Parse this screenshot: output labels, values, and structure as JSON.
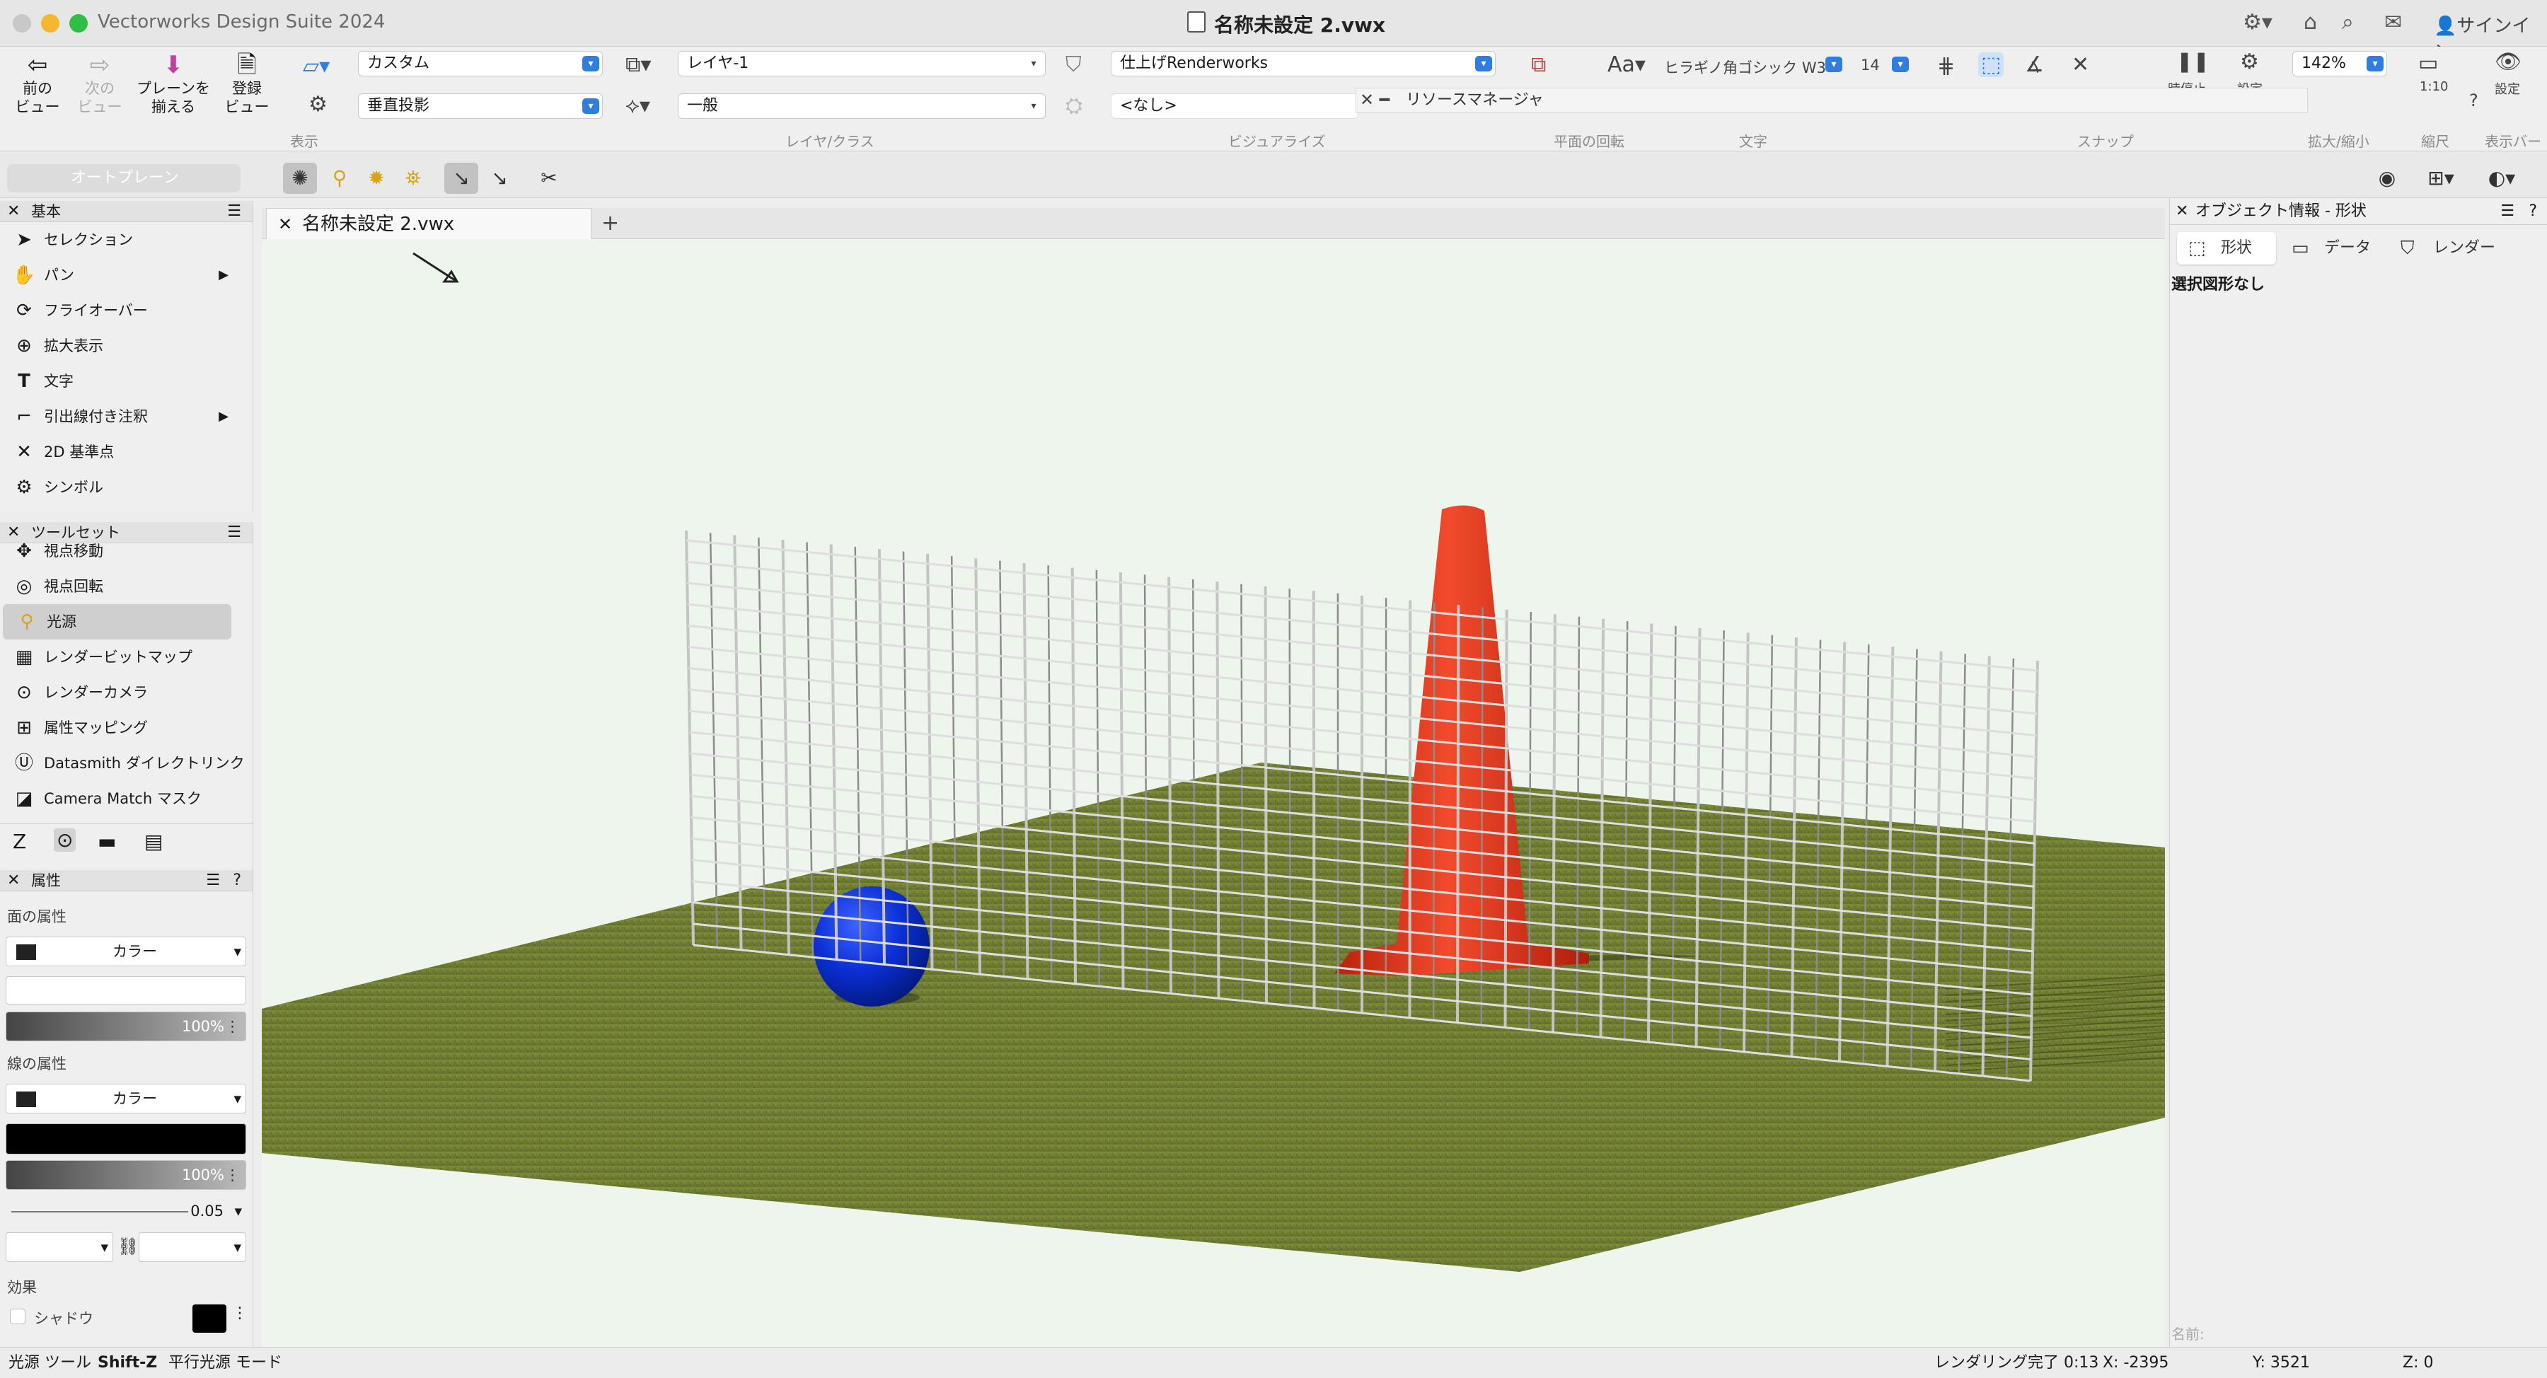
{
  "window": {
    "app_title": "Vectorworks Design Suite 2024",
    "doc_title": "名称未設定 2.vwx",
    "signin": "サインイン"
  },
  "nav": {
    "prev_view": "前の\nビュー",
    "next_view": "次の\nビュー",
    "align_plane": "プレーンを\n揃える",
    "saved_view": "登録\nビュー"
  },
  "toolbar": {
    "view_group": "表示",
    "layer_group": "レイヤ/クラス",
    "visualize_group": "ビジュアライズ",
    "plane_rot_group": "平面の回転",
    "text_group": "文字",
    "snap_group": "スナップ",
    "zoom_group": "拡大/縮小",
    "scale_group": "縮尺",
    "displaybar_group": "表示バー",
    "view_dd": "カスタム",
    "projection_dd": "垂直投影",
    "layer_dd": "レイヤ-1",
    "class_dd": "一般",
    "render_dd": "仕上げRenderworks",
    "light_dd": "<なし>",
    "font_dd": "ヒラギノ角ゴシック W3",
    "font_size": "14",
    "pause_label": "一時停止",
    "settings_label": "設定",
    "zoom_value": "142%",
    "scale_value": "1:10",
    "display_label": "設定"
  },
  "resource_manager": {
    "title": "リソースマネージャ"
  },
  "modebar": {
    "plane_dd": "オートプレーン"
  },
  "basic_palette": {
    "title": "基本",
    "tools": [
      {
        "label": "セレクション",
        "icon": "arrow"
      },
      {
        "label": "パン",
        "icon": "hand"
      },
      {
        "label": "フライオーバー",
        "icon": "flyover"
      },
      {
        "label": "拡大表示",
        "icon": "zoom"
      },
      {
        "label": "文字",
        "icon": "text"
      },
      {
        "label": "引出線付き注釈",
        "icon": "callout"
      },
      {
        "label": "2D 基準点",
        "icon": "locus"
      },
      {
        "label": "シンボル",
        "icon": "symbol"
      }
    ]
  },
  "toolset_palette": {
    "title": "ツールセット",
    "tools": [
      {
        "label": "視点移動",
        "icon": "walkthrough"
      },
      {
        "label": "視点回転",
        "icon": "rotate-view"
      },
      {
        "label": "光源",
        "icon": "light"
      },
      {
        "label": "レンダービットマップ",
        "icon": "render-bitmap"
      },
      {
        "label": "レンダーカメラ",
        "icon": "camera"
      },
      {
        "label": "属性マッピング",
        "icon": "attribute-mapping"
      },
      {
        "label": "Datasmith ダイレクトリンク",
        "icon": "datasmith"
      },
      {
        "label": "Camera Match マスク",
        "icon": "camera-match"
      }
    ]
  },
  "attributes_palette": {
    "title": "属性",
    "fill_label": "面の属性",
    "fill_type": "カラー",
    "fill_opacity": "100%",
    "pen_label": "線の属性",
    "pen_type": "カラー",
    "pen_opacity": "100%",
    "line_weight": "0.05",
    "effects_label": "効果",
    "shadow_label": "シャドウ"
  },
  "document_tab": {
    "label": "名称未設定 2.vwx"
  },
  "object_info": {
    "title": "オブジェクト情報 - 形状",
    "tabs": [
      "形状",
      "データ",
      "レンダー"
    ],
    "no_selection": "選択図形なし",
    "name_label": "名前:"
  },
  "status": {
    "tool": "光源 ツール",
    "shortcut": "Shift-Z",
    "mode": "平行光源 モード",
    "render": "レンダリング完了 0:13",
    "x": "X: -2395",
    "y": "Y: 3521",
    "z": "Z: 0"
  },
  "scene": {
    "sphere_color": "#0a2fd6",
    "cone_color": "#e0321a",
    "grass_color": "#6f7a35",
    "fence_color": "#c4c4c4"
  }
}
